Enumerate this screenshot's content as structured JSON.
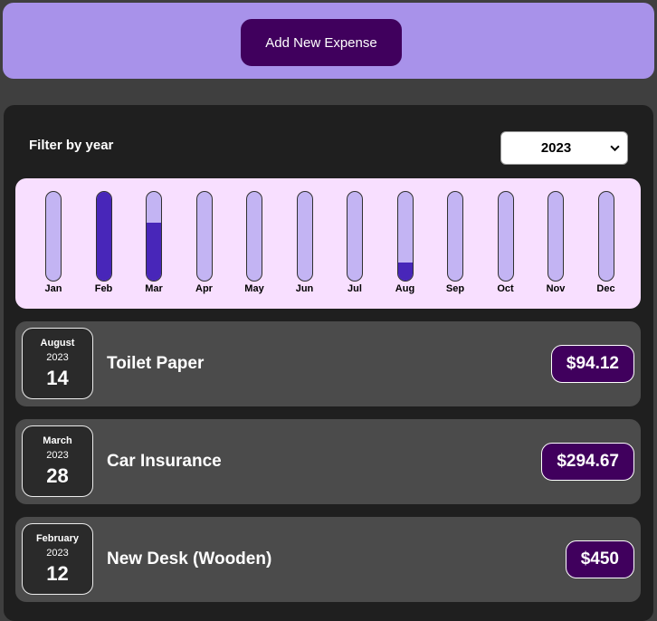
{
  "new_expense": {
    "button_label": "Add New Expense"
  },
  "filter": {
    "label": "Filter by year",
    "selected_year": "2023"
  },
  "chart_data": {
    "type": "bar",
    "categories": [
      "Jan",
      "Feb",
      "Mar",
      "Apr",
      "May",
      "Jun",
      "Jul",
      "Aug",
      "Sep",
      "Oct",
      "Nov",
      "Dec"
    ],
    "values": [
      0,
      450,
      294.67,
      0,
      0,
      0,
      0,
      94.12,
      0,
      0,
      0,
      0
    ],
    "ylim": [
      0,
      450
    ]
  },
  "expenses": [
    {
      "month": "August",
      "year": "2023",
      "day": "14",
      "title": "Toilet Paper",
      "amount": "$94.12"
    },
    {
      "month": "March",
      "year": "2023",
      "day": "28",
      "title": "Car Insurance",
      "amount": "$294.67"
    },
    {
      "month": "February",
      "year": "2023",
      "day": "12",
      "title": "New Desk (Wooden)",
      "amount": "$450"
    }
  ],
  "colors": {
    "header_bg": "#a892ea",
    "button_bg": "#40005d",
    "chart_bg": "#f8dfff",
    "bar_track": "#c3b4f3",
    "bar_fill": "#4826b9"
  }
}
